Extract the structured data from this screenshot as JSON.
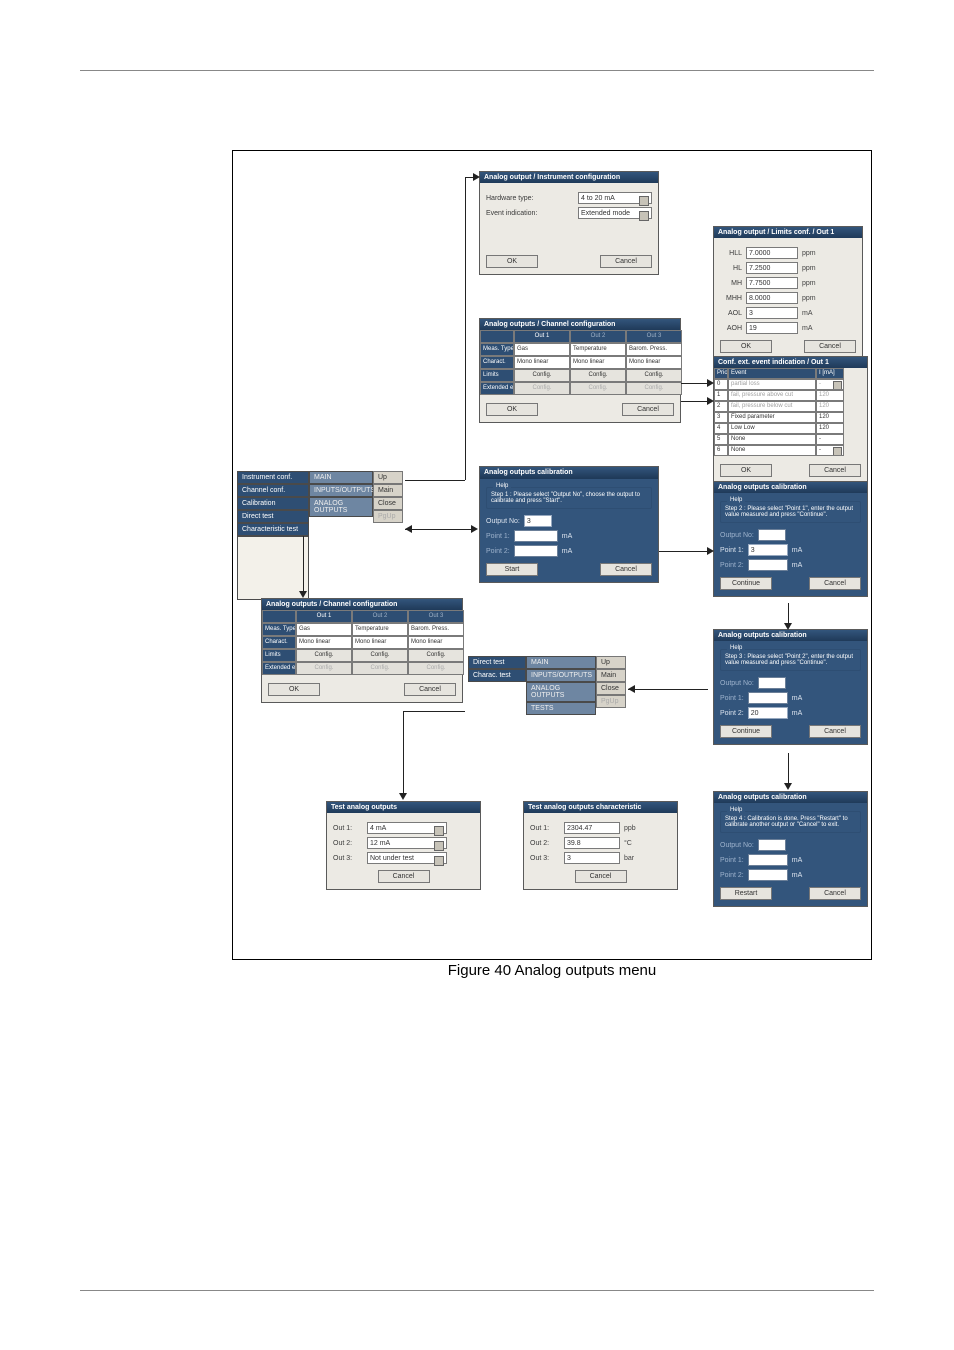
{
  "caption": "Figure 40  Analog outputs menu",
  "arrows": [
    "right",
    "left",
    "down"
  ],
  "instr_conf": {
    "title": "Analog output / Instrument configuration",
    "hw_label": "Hardware type:",
    "hw_value": "4 to 20 mA",
    "evt_label": "Event indication:",
    "evt_value": "Extended mode",
    "ok": "OK",
    "cancel": "Cancel"
  },
  "limits": {
    "title": "Analog output / Limits conf. / Out 1",
    "rows": [
      {
        "k": "HLL",
        "v": "7.0000",
        "u": "ppm"
      },
      {
        "k": "HL",
        "v": "7.2500",
        "u": "ppm"
      },
      {
        "k": "MH",
        "v": "7.7500",
        "u": "ppm"
      },
      {
        "k": "MHH",
        "v": "8.0000",
        "u": "ppm"
      },
      {
        "k": "AOL",
        "v": "3",
        "u": "mA"
      },
      {
        "k": "AOH",
        "v": "19",
        "u": "mA"
      }
    ],
    "ok": "OK",
    "cancel": "Cancel"
  },
  "chan_conf_top": {
    "title": "Analog outputs / Channel configuration",
    "tabs": [
      "Out 1",
      "Out 2",
      "Out 3"
    ],
    "tab_active": 0,
    "side": [
      "Meas. Type",
      "Charact.",
      "Limits",
      "Extended events"
    ],
    "row_meas": [
      "Gas",
      "Temperature",
      "Barom. Press."
    ],
    "row_char": [
      "Mono linear",
      "Mono linear",
      "Mono linear"
    ],
    "row_lim": [
      "Config.",
      "Config.",
      "Config."
    ],
    "row_ext": [
      "Config.",
      "Config.",
      "Config."
    ],
    "ok": "OK",
    "cancel": "Cancel"
  },
  "evt_ind": {
    "title": "Conf. ext. event indication / Out 1",
    "headers": [
      "Priority",
      "Event",
      "I [mA]"
    ],
    "rows": [
      [
        "0",
        "partial loss",
        "-"
      ],
      [
        "1",
        "fail, pressure above cut",
        "120"
      ],
      [
        "2",
        "fail, pressure below cut",
        "120"
      ],
      [
        "3",
        "Fixed parameter",
        "120"
      ],
      [
        "4",
        "Low Low",
        "120"
      ],
      [
        "5",
        "None",
        "-"
      ],
      [
        "6",
        "None",
        "-"
      ]
    ],
    "ok": "OK",
    "cancel": "Cancel"
  },
  "left_nav": {
    "col1": [
      "Instrument conf.",
      "Channel conf.",
      "Calibration",
      "Direct test",
      "Characteristic test"
    ],
    "col2_top": "MAIN",
    "col2_items": [
      "INPUTS/OUTPUTS",
      "ANALOG OUTPUTS"
    ],
    "col3": [
      "Up",
      "Main",
      "Close",
      "PgUp"
    ]
  },
  "chan_conf_left": {
    "title": "Analog outputs / Channel configuration",
    "tabs": [
      "Out 1",
      "Out 2",
      "Out 3"
    ],
    "side": [
      "Meas. Type",
      "Charact.",
      "Limits",
      "Extended events"
    ],
    "row_meas": [
      "Gas",
      "Temperature",
      "Barom. Press."
    ],
    "row_char": [
      "Mono linear",
      "Mono linear",
      "Mono linear"
    ],
    "row_lim": [
      "Config.",
      "Config.",
      "Config."
    ],
    "row_ext": [
      "Config.",
      "Config.",
      "Config."
    ],
    "ok": "OK",
    "cancel": "Cancel"
  },
  "calib1": {
    "title": "Analog outputs calibration",
    "help_legend": "Help",
    "help": "Step 1 : Please select \"Output No\", choose the output to calibrate and press \"Start\".",
    "out_lbl": "Output No:",
    "out_val": "3",
    "p1_lbl": "Point 1:",
    "p1_val": "",
    "p1_u": "mA",
    "p2_lbl": "Point 2:",
    "p2_val": "",
    "p2_u": "mA",
    "start": "Start",
    "cancel": "Cancel"
  },
  "calib2": {
    "title": "Analog outputs calibration",
    "help_legend": "Help",
    "help": "Step 2 : Please select \"Point 1\", enter the output value measured and press \"Continue\".",
    "out_lbl": "Output No:",
    "out_val": "",
    "p1_lbl": "Point 1:",
    "p1_val": "3",
    "p1_u": "mA",
    "p2_lbl": "Point 2:",
    "p2_val": "",
    "p2_u": "mA",
    "cont": "Continue",
    "cancel": "Cancel"
  },
  "calib3": {
    "title": "Analog outputs calibration",
    "help_legend": "Help",
    "help": "Step 3 : Please select \"Point 2\", enter the output value measured and press \"Continue\".",
    "out_lbl": "Output No:",
    "out_val": "",
    "p1_lbl": "Point 1:",
    "p1_val": "",
    "p1_u": "mA",
    "p2_lbl": "Point 2:",
    "p2_val": "20",
    "p2_u": "mA",
    "cont": "Continue",
    "cancel": "Cancel"
  },
  "calib4": {
    "title": "Analog outputs calibration",
    "help_legend": "Help",
    "help": "Step 4 : Calibration is done. Press \"Restart\" to calibrate another output or \"Cancel\" to exit.",
    "out_lbl": "Output No:",
    "out_val": "",
    "p1_lbl": "Point 1:",
    "p1_val": "",
    "p1_u": "mA",
    "p2_lbl": "Point 2:",
    "p2_val": "",
    "p2_u": "mA",
    "restart": "Restart",
    "cancel": "Cancel"
  },
  "mid_nav": {
    "col1": [
      "Direct test",
      "Charac. test"
    ],
    "col2_top": "MAIN",
    "col2_items": [
      "INPUTS/OUTPUTS",
      "ANALOG OUTPUTS",
      "TESTS"
    ],
    "col3": [
      "Up",
      "Main",
      "Close",
      "PgUp"
    ]
  },
  "test_direct": {
    "title": "Test analog outputs",
    "rows": [
      {
        "k": "Out 1:",
        "v": "4 mA"
      },
      {
        "k": "Out 2:",
        "v": "12 mA"
      },
      {
        "k": "Out 3:",
        "v": "Not under test"
      }
    ],
    "cancel": "Cancel"
  },
  "test_char": {
    "title": "Test analog outputs characteristic",
    "rows": [
      {
        "k": "Out 1:",
        "v": "2304.47",
        "u": "ppb"
      },
      {
        "k": "Out 2:",
        "v": "39.8",
        "u": "°C"
      },
      {
        "k": "Out 3:",
        "v": "3",
        "u": "bar"
      }
    ],
    "cancel": "Cancel"
  }
}
